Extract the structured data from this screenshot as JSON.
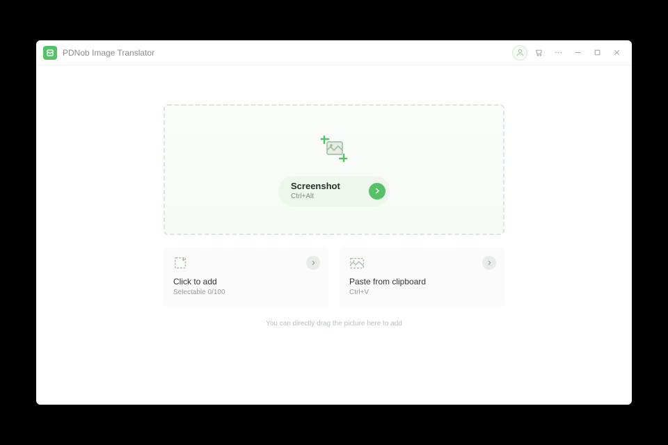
{
  "header": {
    "app_title": "PDNob Image Translator"
  },
  "dropzone": {
    "primary_label": "Screenshot",
    "primary_shortcut": "Ctrl+Alt"
  },
  "cards": {
    "add": {
      "title": "Click to add",
      "subtitle": "Selectable 0/100"
    },
    "paste": {
      "title": "Paste from clipboard",
      "subtitle": "Ctrl+V"
    }
  },
  "hint_text": "You can directly drag the picture here to add"
}
